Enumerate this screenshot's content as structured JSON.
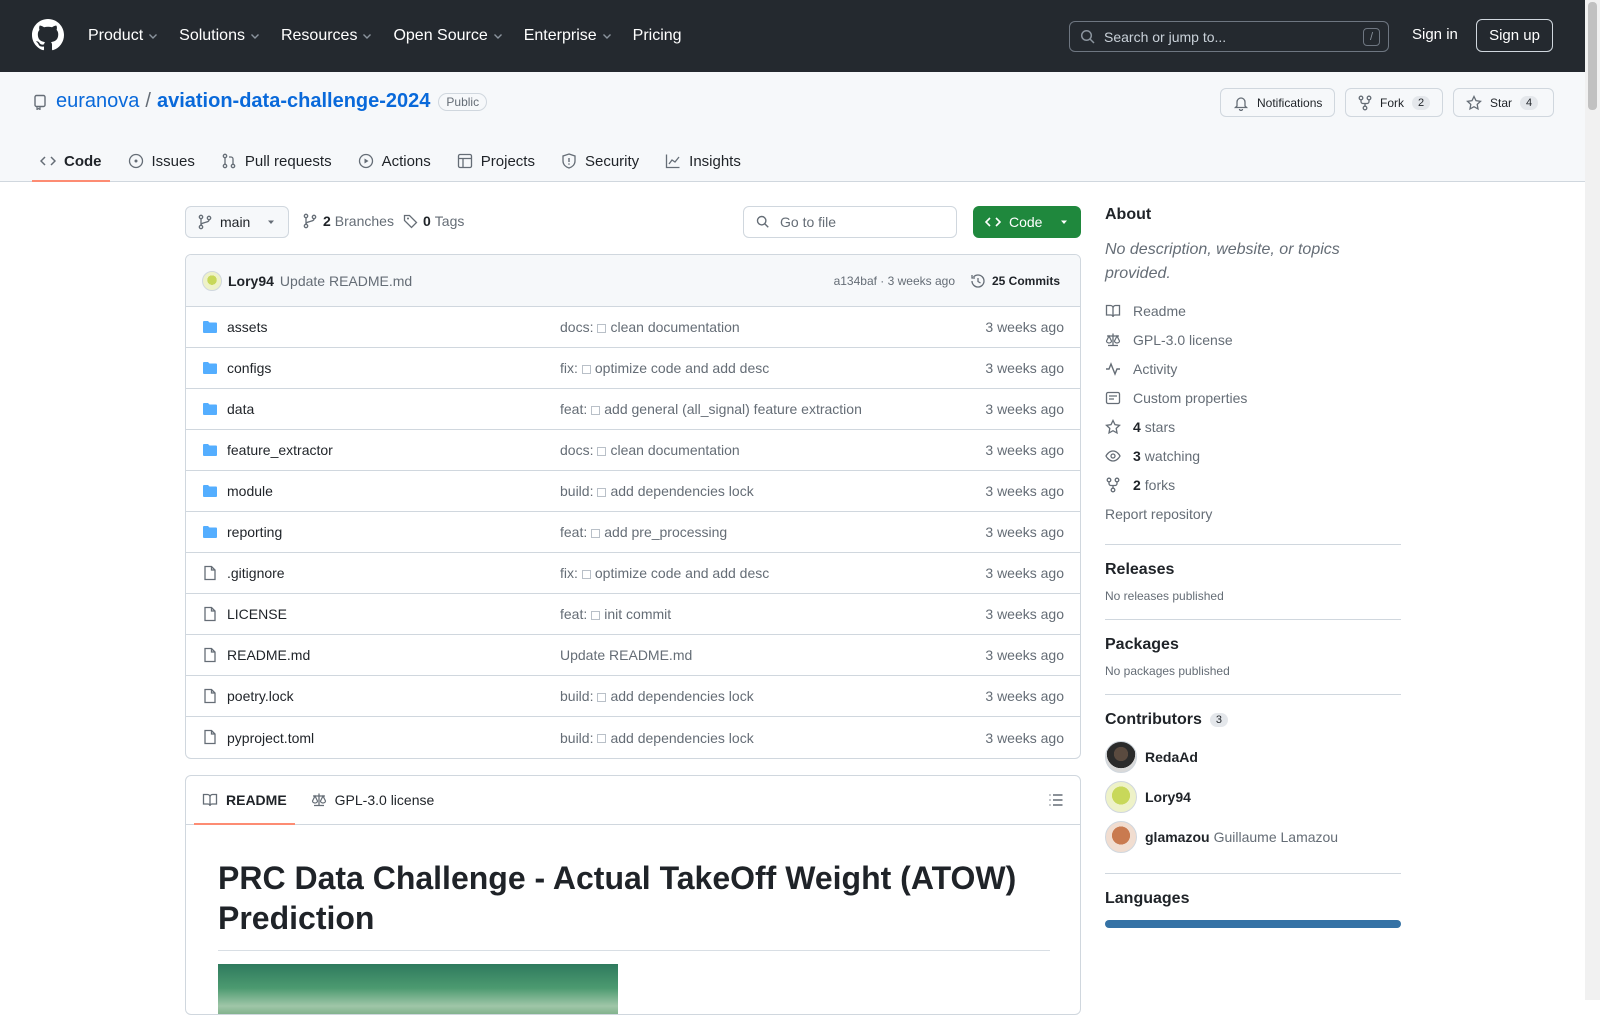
{
  "header": {
    "nav": [
      "Product",
      "Solutions",
      "Resources",
      "Open Source",
      "Enterprise",
      "Pricing"
    ],
    "search_placeholder": "Search or jump to...",
    "search_shortcut": "/",
    "sign_in": "Sign in",
    "sign_up": "Sign up"
  },
  "repo": {
    "owner": "euranova",
    "separator": "/",
    "name": "aviation-data-challenge-2024",
    "visibility": "Public",
    "notifications_label": "Notifications",
    "fork_label": "Fork",
    "fork_count": "2",
    "star_label": "Star",
    "star_count": "4",
    "tabs": [
      {
        "label": "Code",
        "icon": "code-icon"
      },
      {
        "label": "Issues",
        "icon": "issue-icon"
      },
      {
        "label": "Pull requests",
        "icon": "pull-request-icon"
      },
      {
        "label": "Actions",
        "icon": "play-icon"
      },
      {
        "label": "Projects",
        "icon": "table-icon"
      },
      {
        "label": "Security",
        "icon": "shield-icon"
      },
      {
        "label": "Insights",
        "icon": "graph-icon"
      }
    ]
  },
  "toolbar": {
    "branch": "main",
    "branches_count": "2",
    "branches_label": "Branches",
    "tags_count": "0",
    "tags_label": "Tags",
    "go_to_file": "Go to file",
    "code_button": "Code"
  },
  "commit": {
    "author": "Lory94",
    "message": "Update README.md",
    "sha_time": "a134baf · 3 weeks ago",
    "commits_label": "25 Commits"
  },
  "files": [
    {
      "name": "assets",
      "type": "folder",
      "prefix": "docs:",
      "msg": "clean documentation",
      "time": "3 weeks ago"
    },
    {
      "name": "configs",
      "type": "folder",
      "prefix": "fix:",
      "msg": "optimize code and add desc",
      "time": "3 weeks ago"
    },
    {
      "name": "data",
      "type": "folder",
      "prefix": "feat:",
      "msg": "add general (all_signal) feature extraction",
      "time": "3 weeks ago"
    },
    {
      "name": "feature_extractor",
      "type": "folder",
      "prefix": "docs:",
      "msg": "clean documentation",
      "time": "3 weeks ago"
    },
    {
      "name": "module",
      "type": "folder",
      "prefix": "build:",
      "msg": "add dependencies lock",
      "time": "3 weeks ago"
    },
    {
      "name": "reporting",
      "type": "folder",
      "prefix": "feat:",
      "msg": "add pre_processing",
      "time": "3 weeks ago"
    },
    {
      "name": ".gitignore",
      "type": "file",
      "prefix": "fix:",
      "msg": "optimize code and add desc",
      "time": "3 weeks ago"
    },
    {
      "name": "LICENSE",
      "type": "file",
      "prefix": "feat:",
      "msg": "init commit",
      "time": "3 weeks ago"
    },
    {
      "name": "README.md",
      "type": "file",
      "prefix": "",
      "msg": "Update README.md",
      "time": "3 weeks ago"
    },
    {
      "name": "poetry.lock",
      "type": "file",
      "prefix": "build:",
      "msg": "add dependencies lock",
      "time": "3 weeks ago"
    },
    {
      "name": "pyproject.toml",
      "type": "file",
      "prefix": "build:",
      "msg": "add dependencies lock",
      "time": "3 weeks ago"
    }
  ],
  "readme": {
    "tab_readme": "README",
    "tab_license": "GPL-3.0 license",
    "title": "PRC Data Challenge - Actual TakeOff Weight (ATOW) Prediction"
  },
  "sidebar": {
    "about_title": "About",
    "description": "No description, website, or topics provided.",
    "links": [
      {
        "icon": "book-icon",
        "bold": "",
        "label": "Readme"
      },
      {
        "icon": "law-icon",
        "bold": "",
        "label": "GPL-3.0 license"
      },
      {
        "icon": "pulse-icon",
        "bold": "",
        "label": "Activity"
      },
      {
        "icon": "note-icon",
        "bold": "",
        "label": "Custom properties"
      },
      {
        "icon": "star-icon",
        "bold": "4",
        "label": "stars"
      },
      {
        "icon": "eye-icon",
        "bold": "3",
        "label": "watching"
      },
      {
        "icon": "fork-icon",
        "bold": "2",
        "label": "forks"
      }
    ],
    "report": "Report repository",
    "releases_title": "Releases",
    "releases_text": "No releases published",
    "packages_title": "Packages",
    "packages_text": "No packages published",
    "contributors_title": "Contributors",
    "contributors_count": "3",
    "contributors": [
      {
        "login": "RedaAd",
        "name": ""
      },
      {
        "login": "Lory94",
        "name": ""
      },
      {
        "login": "glamazou",
        "name": "Guillaume Lamazou"
      }
    ],
    "languages_title": "Languages"
  },
  "colors": {
    "header_bg": "#24292f",
    "link_blue": "#0969da",
    "code_button_green": "#1f883d",
    "tab_underline": "#fd8c73",
    "folder_blue": "#54aeff"
  }
}
